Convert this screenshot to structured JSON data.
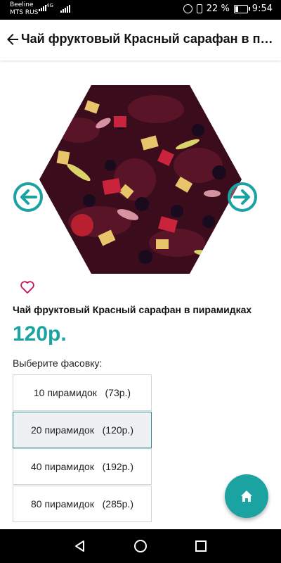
{
  "status_bar": {
    "carrier1": "Beeline",
    "carrier2": "MTS RUS",
    "network_type": "4G",
    "battery_percent": "22 %",
    "time": "9:54"
  },
  "header": {
    "title": "Чай фруктовый Красный сарафан в пир..."
  },
  "product": {
    "name": "Чай фруктовый Красный сарафан в пирамидках",
    "price": "120р.",
    "package_label": "Выберите фасовку:",
    "packages": [
      {
        "label": "10 пирамидок   (73р.)",
        "selected": false
      },
      {
        "label": "20 пирамидок   (120р.)",
        "selected": true
      },
      {
        "label": "40 пирамидок   (192р.)",
        "selected": false
      },
      {
        "label": "80 пирамидок   (285р.)",
        "selected": false
      }
    ]
  },
  "icons": {
    "back": "arrow-left-icon",
    "prev_image": "arrow-left-circle-icon",
    "next_image": "arrow-right-circle-icon",
    "favorite": "heart-outline-icon",
    "home": "home-icon",
    "nav_back": "triangle-back-icon",
    "nav_home": "circle-home-icon",
    "nav_recent": "square-recent-icon"
  },
  "colors": {
    "accent": "#1aa3a0",
    "favorite": "#c2185b",
    "arrow": "#1aa3a0"
  }
}
